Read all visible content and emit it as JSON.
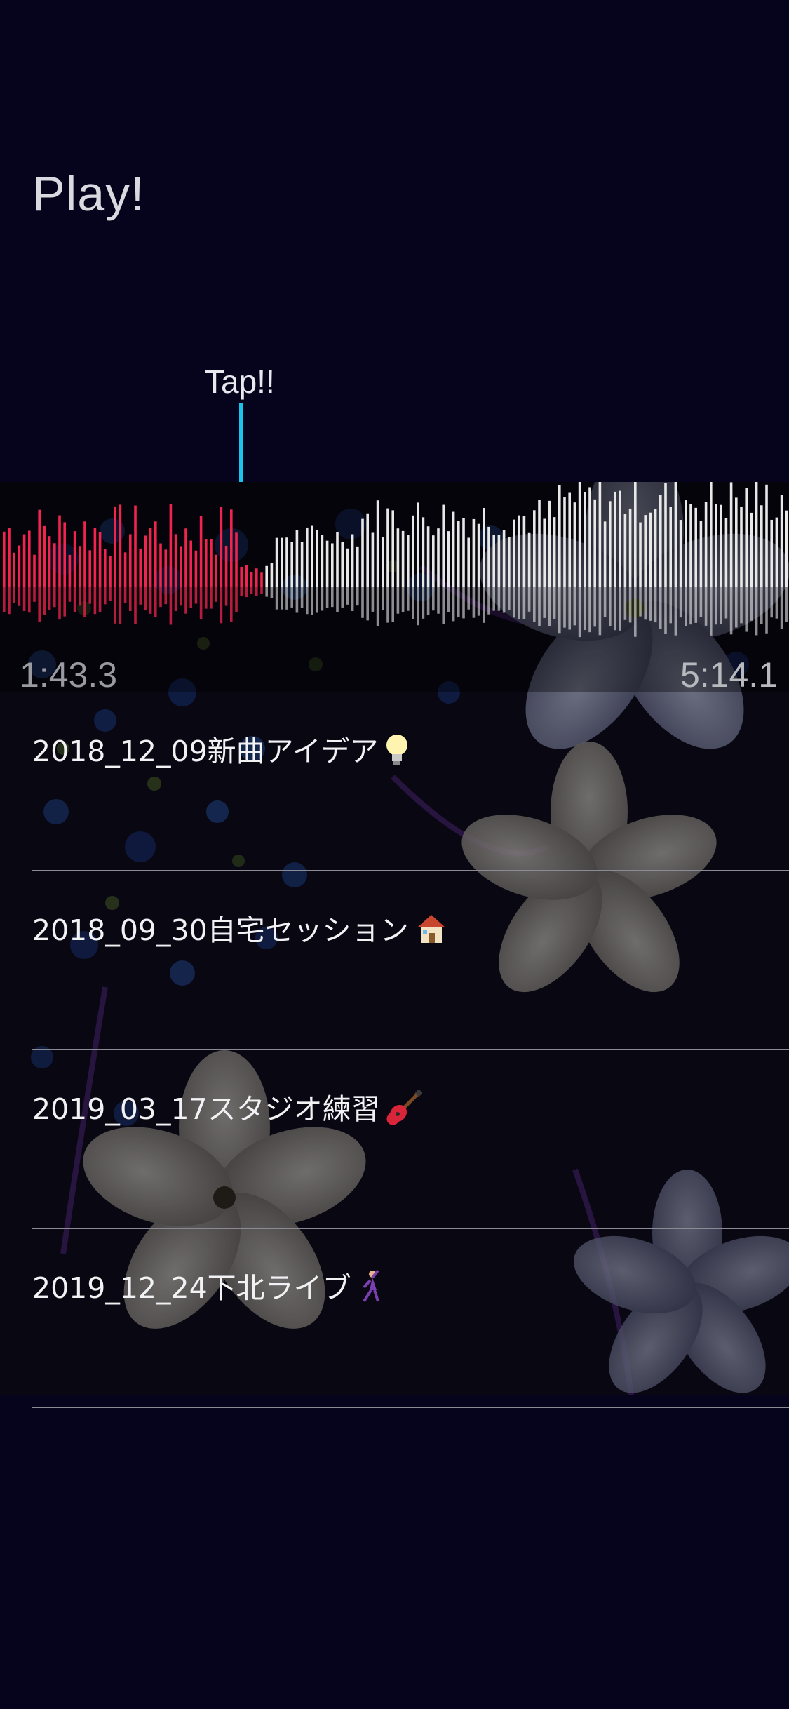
{
  "app": {
    "title": "Play!"
  },
  "annotation": {
    "tap_label": "Tap!!"
  },
  "player": {
    "current_time": "1:43.3",
    "total_time": "5:14.1",
    "progress": 0.33,
    "played_color": "#f0244f",
    "unplayed_color": "#e8e8e8"
  },
  "tracks": [
    {
      "title": "2018_12_09新曲アイデア",
      "icon": "lightbulb-icon"
    },
    {
      "title": "2018_09_30自宅セッション",
      "icon": "house-icon"
    },
    {
      "title": "2019_03_17スタジオ練習",
      "icon": "guitar-icon"
    },
    {
      "title": "2019_12_24下北ライブ",
      "icon": "dancer-icon"
    }
  ]
}
